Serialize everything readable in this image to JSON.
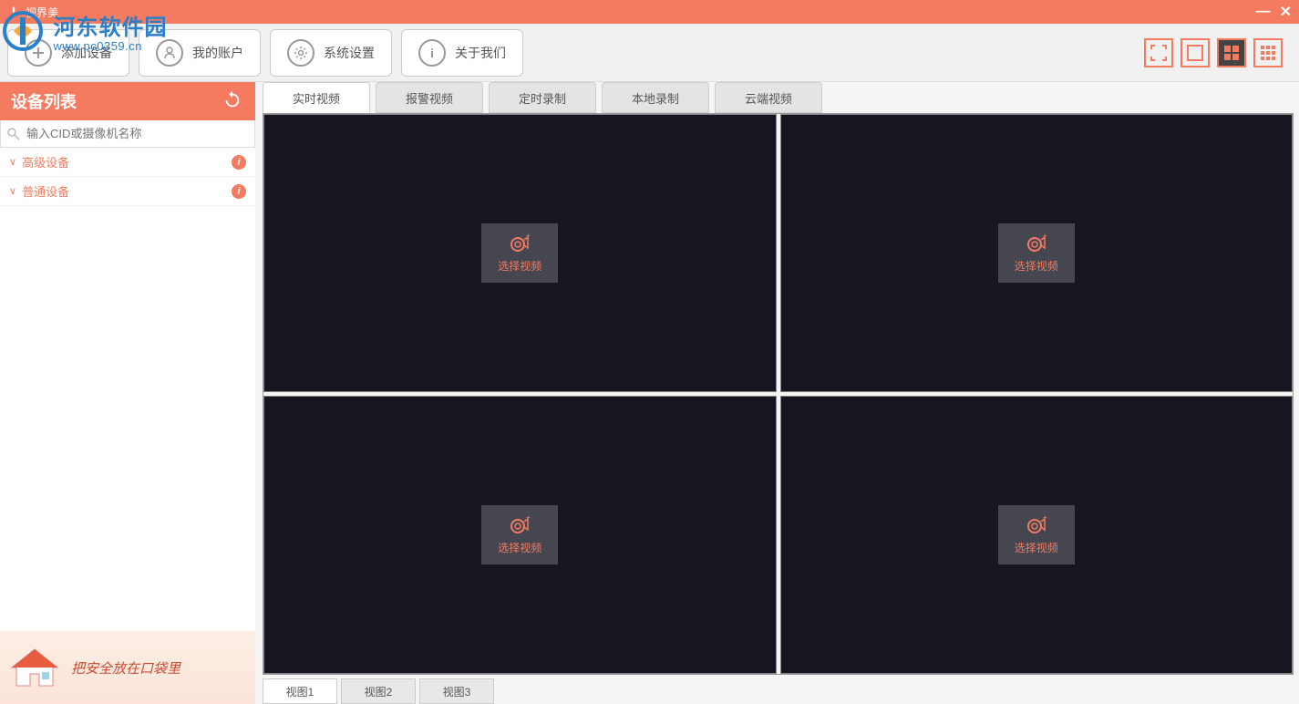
{
  "app": {
    "title": "视界美"
  },
  "watermark": {
    "line1": "河东软件园",
    "line2": "www.pc0359.cn"
  },
  "toolbar": {
    "add_device": "添加设备",
    "my_account": "我的账户",
    "system_settings": "系统设置",
    "about_us": "关于我们"
  },
  "layout_icons": [
    "fullscreen",
    "single",
    "grid4",
    "grid9"
  ],
  "sidebar": {
    "header": "设备列表",
    "search_placeholder": "输入CID或摄像机名称",
    "groups": [
      {
        "label": "高级设备"
      },
      {
        "label": "普通设备"
      }
    ],
    "slogan": "把安全放在口袋里"
  },
  "tabs": [
    {
      "label": "实时视频",
      "active": true
    },
    {
      "label": "报警视频",
      "active": false
    },
    {
      "label": "定时录制",
      "active": false
    },
    {
      "label": "本地录制",
      "active": false
    },
    {
      "label": "云端视频",
      "active": false
    }
  ],
  "video_cells": {
    "select_label": "选择视频",
    "count": 4
  },
  "view_tabs": [
    {
      "label": "视图1",
      "active": true
    },
    {
      "label": "视图2",
      "active": false
    },
    {
      "label": "视图3",
      "active": false
    }
  ],
  "colors": {
    "accent": "#f47b5f"
  }
}
